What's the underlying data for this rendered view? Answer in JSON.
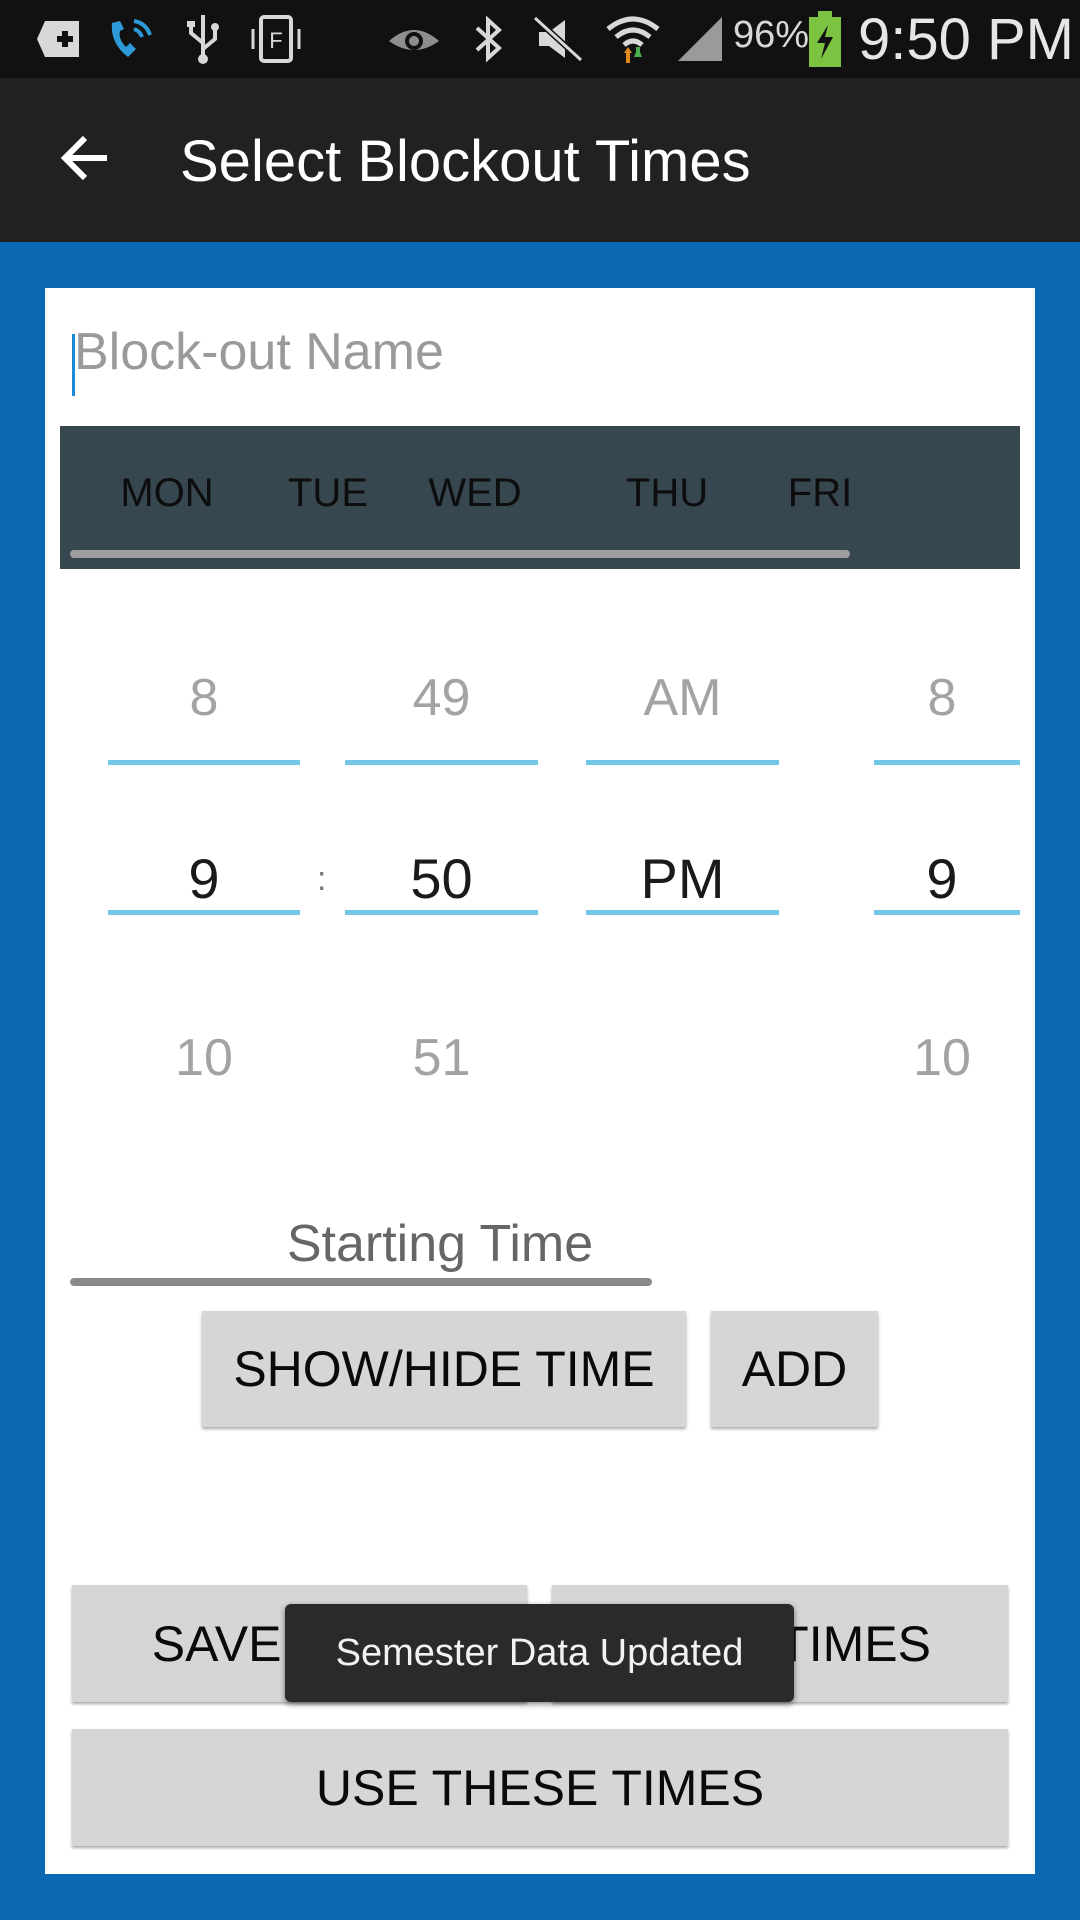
{
  "status_bar": {
    "icons": [
      "add-box-icon",
      "wifi-call-icon",
      "usb-icon",
      "nfc-icon",
      "eye-icon",
      "bluetooth-icon",
      "mute-icon",
      "wifi-icon",
      "signal-icon",
      "battery-charging-icon"
    ],
    "battery_percent": "96%",
    "time": "9:50 PM"
  },
  "app_bar": {
    "back_icon": "arrow-back-icon",
    "title": "Select Blockout Times"
  },
  "name_field": {
    "placeholder": "Block-out Name",
    "value": ""
  },
  "days": [
    "MON",
    "TUE",
    "WED",
    "THU",
    "FRI"
  ],
  "start_picker": {
    "hour": {
      "prev": "8",
      "selected": "9",
      "next": "10"
    },
    "minute": {
      "prev": "49",
      "selected": "50",
      "next": "51"
    },
    "ampm": {
      "prev": "AM",
      "selected": "PM",
      "next": ""
    },
    "separator": ":"
  },
  "end_picker": {
    "hour": {
      "prev": "8",
      "selected": "9",
      "next": "10"
    }
  },
  "start_label": "Starting Time",
  "buttons": {
    "show_hide": "SHOW/HIDE TIME",
    "add": "ADD",
    "save": "SAVE TIMES",
    "load": "LOAD TIMES",
    "use": "USE THESE TIMES"
  },
  "toast": "Semester Data Updated",
  "colors": {
    "background": "#0a69b2",
    "app_bar": "#212121",
    "days_bar": "#37474f",
    "accent_underline": "#0f8a86",
    "picker_line": "#74c6e6",
    "button": "#d6d6d6"
  }
}
